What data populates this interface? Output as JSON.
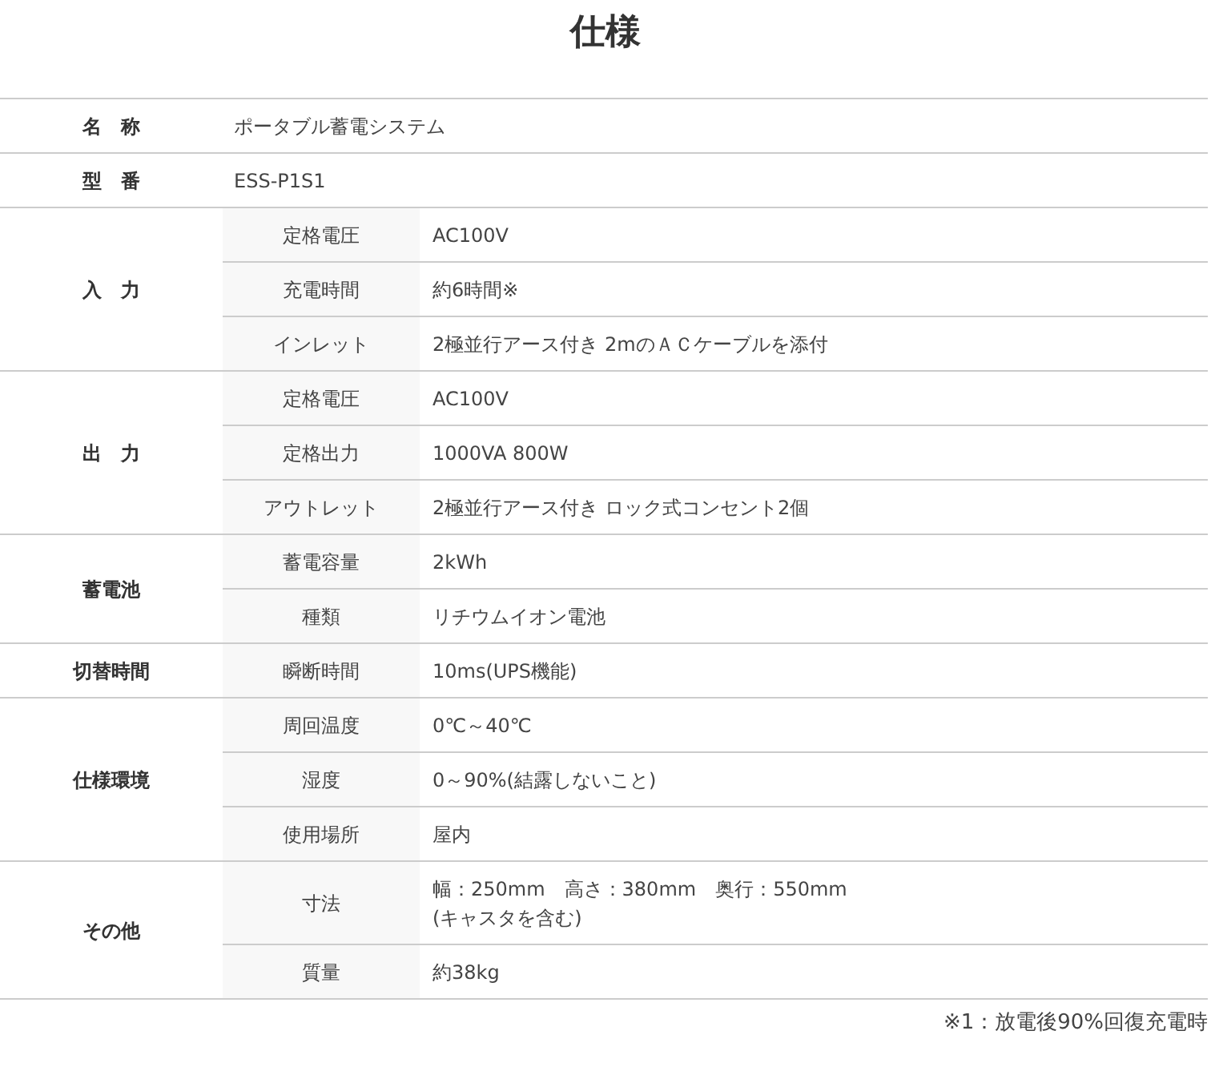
{
  "title": "仕様",
  "groups": [
    {
      "label": "名　称",
      "rows": [
        {
          "value": "ポータブル蓄電システム"
        }
      ]
    },
    {
      "label": "型　番",
      "rows": [
        {
          "value": "ESS-P1S1"
        }
      ]
    },
    {
      "label": "入　力",
      "rows": [
        {
          "label": "定格電圧",
          "value": "AC100V"
        },
        {
          "label": "充電時間",
          "value": "約6時間※"
        },
        {
          "label": "インレット",
          "value": "2極並行アース付き 2mのＡＣケーブルを添付"
        }
      ]
    },
    {
      "label": "出　力",
      "rows": [
        {
          "label": "定格電圧",
          "value": "AC100V"
        },
        {
          "label": "定格出力",
          "value": "1000VA 800W"
        },
        {
          "label": "アウトレット",
          "value": "2極並行アース付き ロック式コンセント2個"
        }
      ]
    },
    {
      "label": "蓄電池",
      "rows": [
        {
          "label": "蓄電容量",
          "value": "2kWh"
        },
        {
          "label": "種類",
          "value": "リチウムイオン電池"
        }
      ]
    },
    {
      "label": "切替時間",
      "rows": [
        {
          "label": "瞬断時間",
          "value": "10ms(UPS機能)"
        }
      ]
    },
    {
      "label": "仕様環境",
      "rows": [
        {
          "label": "周回温度",
          "value": "0℃～40℃"
        },
        {
          "label": "湿度",
          "value": "0～90%(結露しないこと)"
        },
        {
          "label": "使用場所",
          "value": "屋内"
        }
      ]
    },
    {
      "label": "その他",
      "rows": [
        {
          "label": "寸法",
          "value": "幅：250mm　高さ：380mm　奥行：550mm\n(キャスタを含む)"
        },
        {
          "label": "質量",
          "value": "約38kg"
        }
      ]
    }
  ],
  "footnote": "※1：放電後90%回復充電時"
}
